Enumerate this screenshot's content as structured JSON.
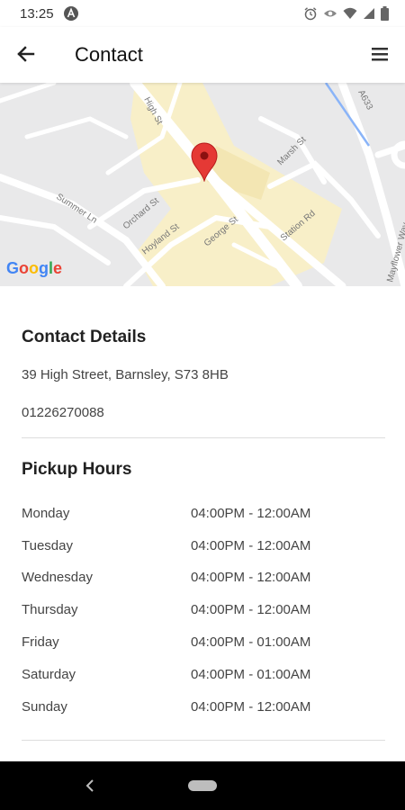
{
  "status_bar": {
    "time": "13:25",
    "icons": [
      "app-notification-icon",
      "alarm-icon",
      "eye-icon",
      "wifi-icon",
      "signal-icon",
      "battery-icon"
    ]
  },
  "app_bar": {
    "title": "Contact",
    "back_icon": "arrow-left-icon",
    "menu_icon": "hamburger-menu-icon"
  },
  "map": {
    "street_labels": [
      "High St",
      "Marsh St",
      "A633",
      "Summer Ln",
      "Orchard St",
      "Hoyland St",
      "George St",
      "Station Rd",
      "Mayflower Way"
    ],
    "attribution": "Google",
    "pin_color": "#e53935"
  },
  "contact_details": {
    "heading": "Contact Details",
    "address": "39 High Street, Barnsley, S73 8HB",
    "phone": "01226270088"
  },
  "pickup_hours": {
    "heading": "Pickup Hours",
    "rows": [
      {
        "day": "Monday",
        "hours": "04:00PM - 12:00AM"
      },
      {
        "day": "Tuesday",
        "hours": "04:00PM - 12:00AM"
      },
      {
        "day": "Wednesday",
        "hours": "04:00PM - 12:00AM"
      },
      {
        "day": "Thursday",
        "hours": "04:00PM - 12:00AM"
      },
      {
        "day": "Friday",
        "hours": "04:00PM - 01:00AM"
      },
      {
        "day": "Saturday",
        "hours": "04:00PM - 01:00AM"
      },
      {
        "day": "Sunday",
        "hours": "04:00PM - 12:00AM"
      }
    ]
  },
  "colors": {
    "map_background": "#e9e9ea",
    "map_highlight": "#f8efc8",
    "road": "#ffffff",
    "water": "#8ab4f8"
  }
}
